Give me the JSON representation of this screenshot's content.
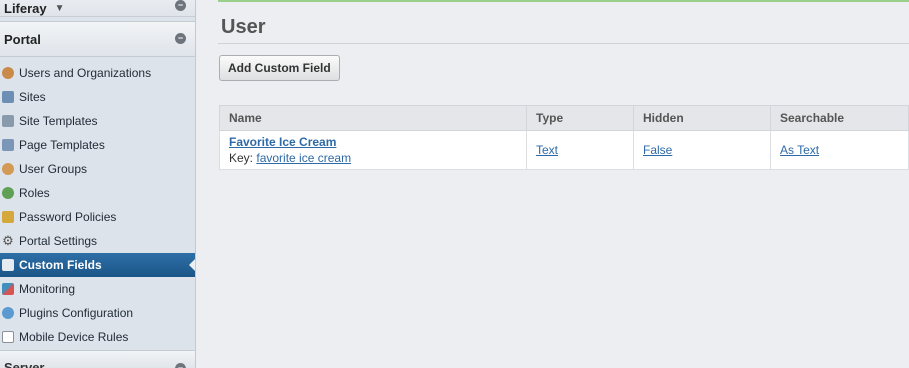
{
  "sidebar": {
    "site_name": "Liferay",
    "panel_title": "Portal",
    "items": [
      {
        "label": "Users and Organizations",
        "icon": "users-icon",
        "color": "#c98a4a"
      },
      {
        "label": "Sites",
        "icon": "sites-icon",
        "color": "#6d8fb3"
      },
      {
        "label": "Site Templates",
        "icon": "site-templates-icon",
        "color": "#8a9aad"
      },
      {
        "label": "Page Templates",
        "icon": "page-templates-icon",
        "color": "#7c96b8"
      },
      {
        "label": "User Groups",
        "icon": "user-groups-icon",
        "color": "#d29a55"
      },
      {
        "label": "Roles",
        "icon": "roles-icon",
        "color": "#5fa055"
      },
      {
        "label": "Password Policies",
        "icon": "password-policies-icon",
        "color": "#d4a83a"
      },
      {
        "label": "Portal Settings",
        "icon": "gear-icon",
        "color": "#555555"
      },
      {
        "label": "Custom Fields",
        "icon": "custom-fields-icon",
        "color": "#e6ebf1",
        "active": true
      },
      {
        "label": "Monitoring",
        "icon": "monitoring-icon",
        "color": "#3f8fbf"
      },
      {
        "label": "Plugins Configuration",
        "icon": "plugins-icon",
        "color": "#5a9ad0"
      },
      {
        "label": "Mobile Device Rules",
        "icon": "mobile-device-icon",
        "color": "#8b9199"
      }
    ],
    "next_panel_title": "Server"
  },
  "main": {
    "title": "User",
    "add_button": "Add Custom Field",
    "columns": [
      "Name",
      "Type",
      "Hidden",
      "Searchable"
    ],
    "rows": [
      {
        "name": "Favorite Ice Cream",
        "key_label": "Key:",
        "key": "favorite ice cream",
        "type": "Text",
        "hidden": "False",
        "searchable": "As Text"
      }
    ]
  },
  "colors": {
    "accent": "#1b5587",
    "link": "#2e6aa7",
    "success_line": "#9ad08a"
  }
}
